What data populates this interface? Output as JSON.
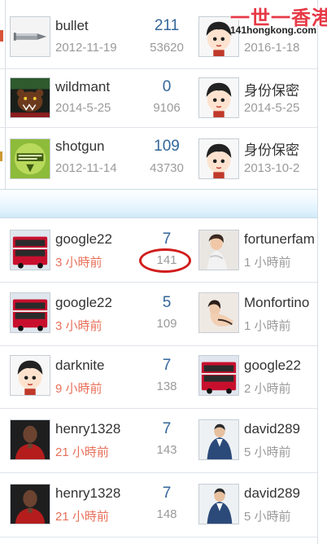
{
  "watermark": {
    "title": "一世一香港",
    "url": "141hongkong.com"
  },
  "threads": [
    {
      "poster": "bullet",
      "posted": "2012-11-19",
      "replies": "211",
      "views": "53620",
      "last_poster": "",
      "last_time": "2016-1-18"
    },
    {
      "poster": "wildmant",
      "posted": "2014-5-25",
      "replies": "0",
      "views": "9106",
      "last_poster": "身份保密",
      "last_time": "2014-5-25"
    },
    {
      "poster": "shotgun",
      "posted": "2012-11-14",
      "replies": "109",
      "views": "43730",
      "last_poster": "身份保密",
      "last_time": "2013-10-2"
    },
    {
      "poster": "google22",
      "posted": "3 小時前",
      "replies": "7",
      "views": "141",
      "last_poster": "fortunerfam",
      "last_time": "1 小時前"
    },
    {
      "poster": "google22",
      "posted": "3 小時前",
      "replies": "5",
      "views": "109",
      "last_poster": "Monfortino",
      "last_time": "1 小時前"
    },
    {
      "poster": "darknite",
      "posted": "9 小時前",
      "replies": "7",
      "views": "138",
      "last_poster": "google22",
      "last_time": "2 小時前"
    },
    {
      "poster": "henry1328",
      "posted": "21 小時前",
      "replies": "7",
      "views": "143",
      "last_poster": "david289",
      "last_time": "5 小時前"
    },
    {
      "poster": "henry1328",
      "posted": "21 小時前",
      "replies": "7",
      "views": "148",
      "last_poster": "david289",
      "last_time": "5 小時前"
    }
  ],
  "colors": {
    "accent_count": "#336699",
    "recent_time": "#e8705a",
    "highlight_circle": "#d11c1c",
    "separator_band": "#dff2fc"
  },
  "icons": [
    "bullet-avatar",
    "bear-avatar",
    "game-logo-avatar",
    "bus-avatar",
    "default-avatar",
    "person-avatar"
  ]
}
